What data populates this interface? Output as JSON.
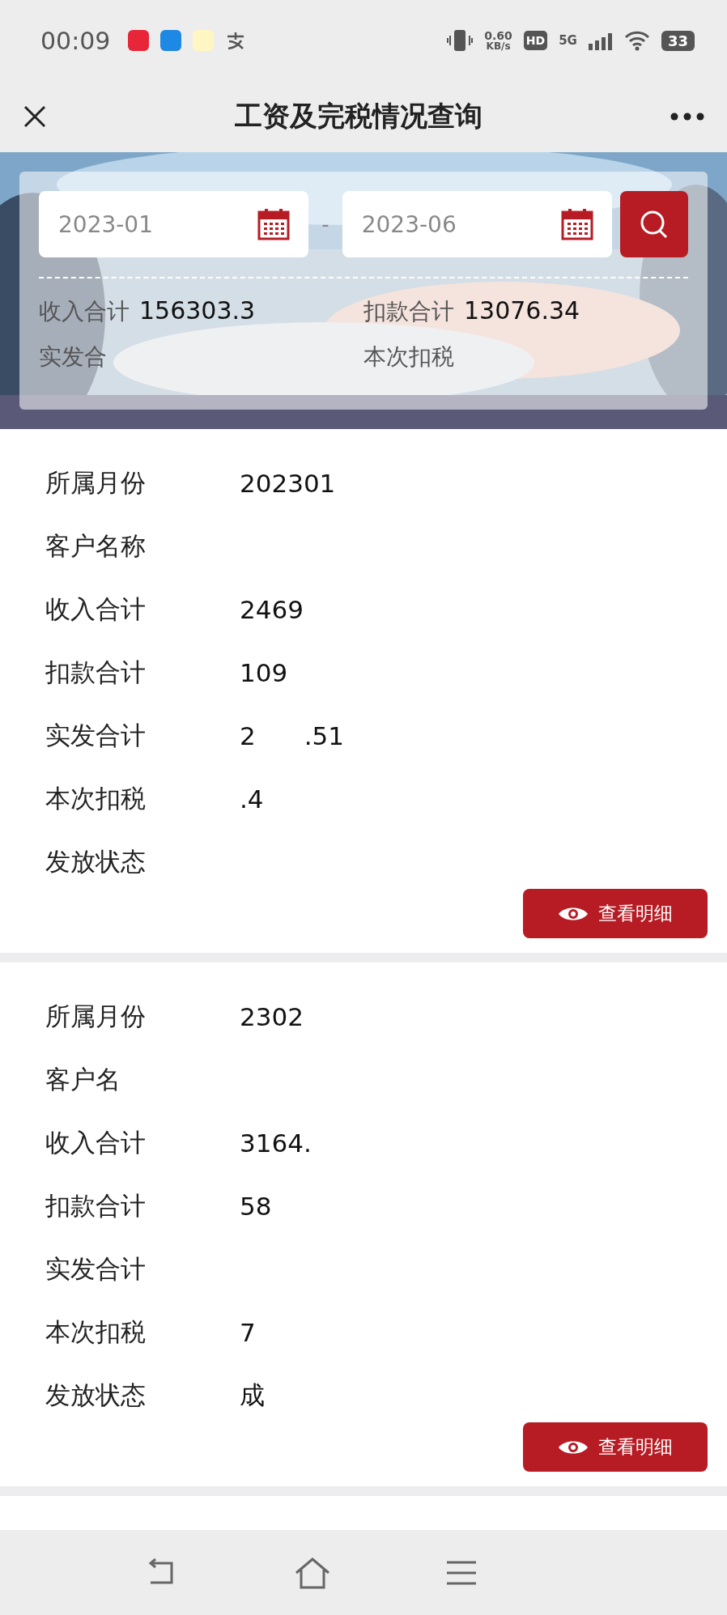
{
  "status_bar": {
    "time": "00:09",
    "speed": "0.60",
    "speed_unit": "KB/s",
    "hd": "HD",
    "network": "5G",
    "battery": "33"
  },
  "nav": {
    "title": "工资及完税情况查询"
  },
  "filter": {
    "start": "2023-01",
    "separator": "-",
    "end": "2023-06"
  },
  "summary": [
    {
      "label": "收入合计",
      "value": "156303.3"
    },
    {
      "label": "扣款合计",
      "value": "13076.34"
    },
    {
      "label": "实发合"
    },
    {
      "label": "本次扣税"
    }
  ],
  "records": [
    {
      "rows": [
        {
          "label": "所属月份",
          "parts": [
            "202301"
          ]
        },
        {
          "label": "客户名称",
          "parts": []
        },
        {
          "label": "收入合计",
          "parts": [
            "2469"
          ]
        },
        {
          "label": "扣款合计",
          "parts": [
            "109"
          ]
        },
        {
          "label": "实发合计",
          "parts": [
            "2",
            ".51"
          ]
        },
        {
          "label": "本次扣税",
          "parts": [
            ".4"
          ]
        },
        {
          "label": "发放状态",
          "parts": []
        }
      ],
      "button": "查看明细"
    },
    {
      "rows": [
        {
          "label": "所属月份",
          "parts": [
            "2302"
          ]
        },
        {
          "label": "客户名",
          "parts": []
        },
        {
          "label": "收入合计",
          "parts": [
            "3164."
          ]
        },
        {
          "label": "扣款合计",
          "parts": [
            "58"
          ]
        },
        {
          "label": "实发合计",
          "parts": []
        },
        {
          "label": "本次扣税",
          "parts": [
            "7"
          ]
        },
        {
          "label": "发放状态",
          "parts": [
            "成"
          ]
        }
      ],
      "button": "查看明细"
    }
  ]
}
